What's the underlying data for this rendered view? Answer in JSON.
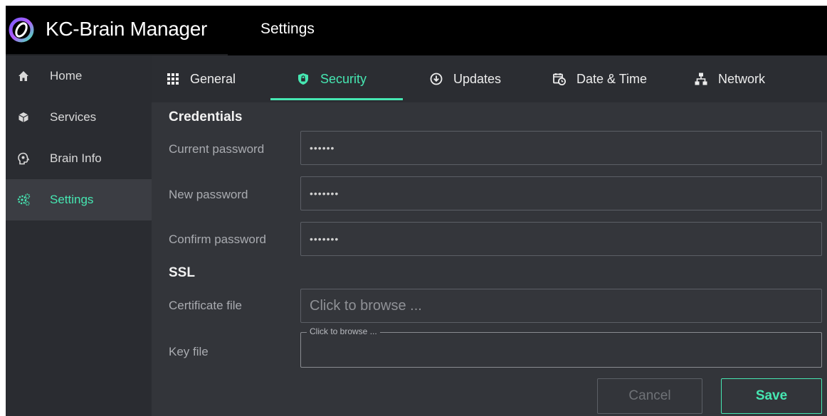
{
  "app": {
    "title": "KC-Brain Manager",
    "page_title": "Settings"
  },
  "sidebar": {
    "items": [
      {
        "label": "Home",
        "icon": "home-icon"
      },
      {
        "label": "Services",
        "icon": "cube-icon"
      },
      {
        "label": "Brain Info",
        "icon": "brain-icon"
      },
      {
        "label": "Settings",
        "icon": "gear-icon",
        "active": true
      }
    ]
  },
  "tabs": [
    {
      "label": "General",
      "icon": "grid-icon"
    },
    {
      "label": "Security",
      "icon": "shield-icon",
      "active": true
    },
    {
      "label": "Updates",
      "icon": "download-icon"
    },
    {
      "label": "Date & Time",
      "icon": "calendar-clock-icon"
    },
    {
      "label": "Network",
      "icon": "network-icon"
    }
  ],
  "security": {
    "credentials_title": "Credentials",
    "current_password": {
      "label": "Current password",
      "value": "••••••"
    },
    "new_password": {
      "label": "New password",
      "value": "•••••••"
    },
    "confirm_password": {
      "label": "Confirm password",
      "value": "•••••••"
    },
    "ssl_title": "SSL",
    "certificate_file": {
      "label": "Certificate file",
      "placeholder": "Click to browse ..."
    },
    "key_file": {
      "label": "Key file",
      "legend": "Click to browse ..."
    }
  },
  "actions": {
    "cancel_label": "Cancel",
    "save_label": "Save"
  },
  "colors": {
    "accent": "#46e7b2",
    "titlebar": "#000000",
    "sidebar": "#2a2c31",
    "content": "#33353a"
  }
}
